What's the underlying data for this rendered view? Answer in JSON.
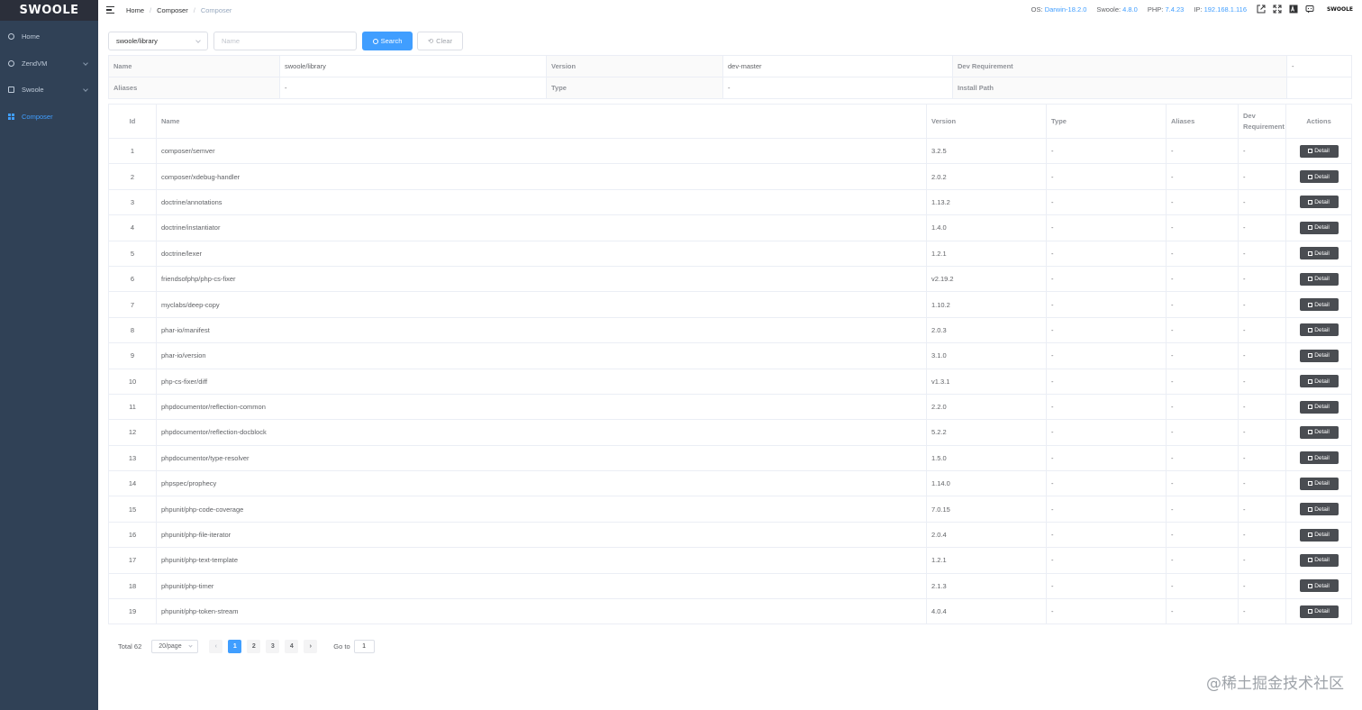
{
  "brand": {
    "logo_text": "SWOOLE",
    "nav_logo_text": "SWOOLE"
  },
  "sidebar": {
    "items": [
      {
        "label": "Home",
        "icon": "home-icon",
        "active": false
      },
      {
        "label": "ZendVM",
        "icon": "zendvm-icon",
        "active": false
      },
      {
        "label": "Swoole",
        "icon": "swoole-icon",
        "active": false
      },
      {
        "label": "Composer",
        "icon": "composer-icon",
        "active": true
      }
    ]
  },
  "breadcrumb": {
    "home": "Home",
    "section": "Composer",
    "current": "Composer"
  },
  "sysinfo": {
    "os_label": "OS:",
    "os_value": "Darwin-18.2.0",
    "swoole_label": "Swoole:",
    "swoole_value": "4.8.0",
    "php_label": "PHP:",
    "php_value": "7.4.23",
    "ip_label": "IP:",
    "ip_value": "192.168.1.116"
  },
  "toolbar_icons": [
    "external-link-icon",
    "fullscreen-icon",
    "text-size-icon",
    "chat-icon"
  ],
  "search": {
    "package_selected": "swoole/library",
    "name_placeholder": "Name",
    "search_label": "Search",
    "clear_label": "Clear"
  },
  "summary": {
    "name_label": "Name",
    "name_value": "swoole/library",
    "version_label": "Version",
    "version_value": "dev-master",
    "devreq_label": "Dev Requirement",
    "devreq_value": "-",
    "aliases_label": "Aliases",
    "aliases_value": "-",
    "type_label": "Type",
    "type_value": "-",
    "install_label": "Install Path",
    "install_value": ""
  },
  "table": {
    "headers": {
      "id": "Id",
      "name": "Name",
      "version": "Version",
      "type": "Type",
      "aliases": "Aliases",
      "dev": "Dev Requirement",
      "actions": "Actions"
    },
    "detail_label": "Detail",
    "rows": [
      {
        "id": "1",
        "name": "composer/semver",
        "version": "3.2.5",
        "type": "-",
        "aliases": "-",
        "dev": "-"
      },
      {
        "id": "2",
        "name": "composer/xdebug-handler",
        "version": "2.0.2",
        "type": "-",
        "aliases": "-",
        "dev": "-"
      },
      {
        "id": "3",
        "name": "doctrine/annotations",
        "version": "1.13.2",
        "type": "-",
        "aliases": "-",
        "dev": "-"
      },
      {
        "id": "4",
        "name": "doctrine/instantiator",
        "version": "1.4.0",
        "type": "-",
        "aliases": "-",
        "dev": "-"
      },
      {
        "id": "5",
        "name": "doctrine/lexer",
        "version": "1.2.1",
        "type": "-",
        "aliases": "-",
        "dev": "-"
      },
      {
        "id": "6",
        "name": "friendsofphp/php-cs-fixer",
        "version": "v2.19.2",
        "type": "-",
        "aliases": "-",
        "dev": "-"
      },
      {
        "id": "7",
        "name": "myclabs/deep-copy",
        "version": "1.10.2",
        "type": "-",
        "aliases": "-",
        "dev": "-"
      },
      {
        "id": "8",
        "name": "phar-io/manifest",
        "version": "2.0.3",
        "type": "-",
        "aliases": "-",
        "dev": "-"
      },
      {
        "id": "9",
        "name": "phar-io/version",
        "version": "3.1.0",
        "type": "-",
        "aliases": "-",
        "dev": "-"
      },
      {
        "id": "10",
        "name": "php-cs-fixer/diff",
        "version": "v1.3.1",
        "type": "-",
        "aliases": "-",
        "dev": "-"
      },
      {
        "id": "11",
        "name": "phpdocumentor/reflection-common",
        "version": "2.2.0",
        "type": "-",
        "aliases": "-",
        "dev": "-"
      },
      {
        "id": "12",
        "name": "phpdocumentor/reflection-docblock",
        "version": "5.2.2",
        "type": "-",
        "aliases": "-",
        "dev": "-"
      },
      {
        "id": "13",
        "name": "phpdocumentor/type-resolver",
        "version": "1.5.0",
        "type": "-",
        "aliases": "-",
        "dev": "-"
      },
      {
        "id": "14",
        "name": "phpspec/prophecy",
        "version": "1.14.0",
        "type": "-",
        "aliases": "-",
        "dev": "-"
      },
      {
        "id": "15",
        "name": "phpunit/php-code-coverage",
        "version": "7.0.15",
        "type": "-",
        "aliases": "-",
        "dev": "-"
      },
      {
        "id": "16",
        "name": "phpunit/php-file-iterator",
        "version": "2.0.4",
        "type": "-",
        "aliases": "-",
        "dev": "-"
      },
      {
        "id": "17",
        "name": "phpunit/php-text-template",
        "version": "1.2.1",
        "type": "-",
        "aliases": "-",
        "dev": "-"
      },
      {
        "id": "18",
        "name": "phpunit/php-timer",
        "version": "2.1.3",
        "type": "-",
        "aliases": "-",
        "dev": "-"
      },
      {
        "id": "19",
        "name": "phpunit/php-token-stream",
        "version": "4.0.4",
        "type": "-",
        "aliases": "-",
        "dev": "-"
      }
    ]
  },
  "pagination": {
    "total": "Total 62",
    "page_size": "20/page",
    "pages": [
      "1",
      "2",
      "3",
      "4"
    ],
    "current": "1",
    "goto_label": "Go to",
    "goto_value": "1"
  },
  "watermark": "@稀土掘金技术社区",
  "colors": {
    "sidebar_bg": "#304156",
    "accent": "#409eff",
    "detail_btn": "#4a4d52"
  }
}
